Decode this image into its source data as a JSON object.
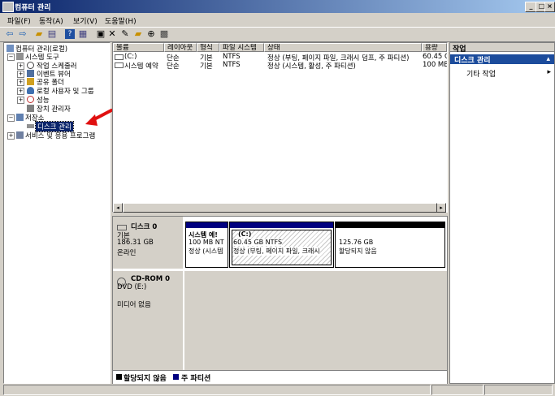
{
  "window": {
    "title": "컴퓨터 관리"
  },
  "menu": [
    "파일(F)",
    "동작(A)",
    "보기(V)",
    "도움말(H)"
  ],
  "tree": {
    "root": "컴퓨터 관리(로컬)",
    "system_tools": "시스템 도구",
    "task_scheduler": "작업 스케줄러",
    "event_viewer": "이벤트 뷰어",
    "shared_folders": "공유 폴더",
    "local_users": "로컬 사용자 및 그룹",
    "performance": "성능",
    "device_manager": "장치 관리자",
    "storage": "저장소",
    "disk_management": "디스크 관리",
    "services_apps": "서비스 및 응용 프로그램"
  },
  "volume_list": {
    "headers": [
      "볼륨",
      "레이아웃",
      "형식",
      "파일 시스템",
      "상태",
      "용량"
    ],
    "rows": [
      [
        "(C:)",
        "단순",
        "기본",
        "NTFS",
        "정상 (부팅, 페이지 파일, 크래시 덤프, 주 파티션)",
        "60.45 GE"
      ],
      [
        "시스템 예약",
        "단순",
        "기본",
        "NTFS",
        "정상 (시스템, 활성, 주 파티션)",
        "100 MB"
      ]
    ]
  },
  "disk0": {
    "name": "디스크 0",
    "type": "기본",
    "size": "186.31 GB",
    "status": "온라인",
    "partitions": [
      {
        "name": "시스템 예!",
        "size": "100 MB NT",
        "status": "정상 (시스템"
      },
      {
        "name": "(C:)",
        "size": "60.45 GB NTFS",
        "status": "정상 (부팅, 페이지 파일, 크래시"
      },
      {
        "name": "",
        "size": "125.76 GB",
        "status": "할당되지 않음"
      }
    ]
  },
  "cdrom": {
    "name": "CD-ROM 0",
    "drive": "DVD (E:)",
    "status": "미디어 없음"
  },
  "legend": {
    "unallocated": "할당되지 않음",
    "primary": "주 파티션"
  },
  "colors": {
    "unallocated": "#000000",
    "primary": "#000080",
    "selection": "#0a246a",
    "arrow": "#e01010"
  },
  "actions": {
    "header": "작업",
    "section": "디스크 관리",
    "item": "기타 작업"
  }
}
